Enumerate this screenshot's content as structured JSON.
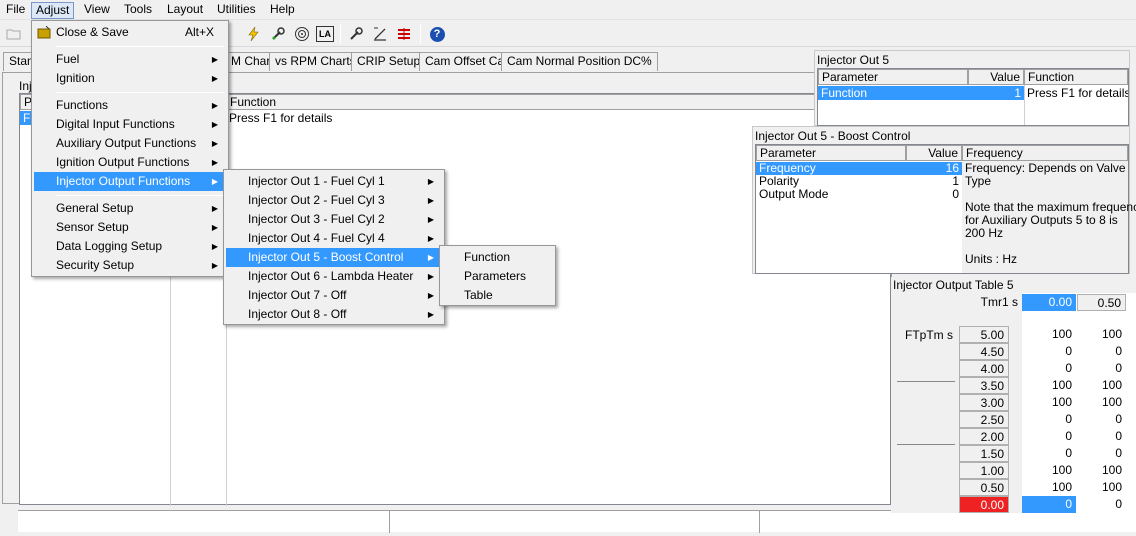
{
  "menubar": [
    "File",
    "Adjust",
    "View",
    "Tools",
    "Layout",
    "Utilities",
    "Help"
  ],
  "toolbar": {
    "icons": [
      "open-icon",
      "lightning-icon",
      "wrench-icon",
      "target-icon",
      "la-icon",
      "wrench2-icon",
      "slope-icon",
      "bars-icon",
      "help-icon"
    ],
    "la_text": "LA",
    "help_text": "?"
  },
  "tabs": [
    "Stan",
    "M Chart",
    "vs RPM Charts",
    "CRIP Setup",
    "Cam Offset Cal",
    "Cam Normal Position DC%"
  ],
  "workarea": {
    "panel_title": "Inj",
    "col_param": "P",
    "col_value": "F",
    "col_function": "Function",
    "function_text": "Press F1 for details"
  },
  "adjust_menu": {
    "items": [
      {
        "label": "Close & Save",
        "accel": "Alt+X"
      },
      {
        "label": "Fuel"
      },
      {
        "label": "Ignition"
      },
      {
        "label": "Functions"
      },
      {
        "label": "Digital Input Functions"
      },
      {
        "label": "Auxiliary Output Functions"
      },
      {
        "label": "Ignition Output Functions"
      },
      {
        "label": "Injector Output Functions"
      },
      {
        "label": "General Setup"
      },
      {
        "label": "Sensor Setup"
      },
      {
        "label": "Data Logging Setup"
      },
      {
        "label": "Security Setup"
      }
    ]
  },
  "injector_menu": {
    "items": [
      "Injector Out 1 - Fuel Cyl 1",
      "Injector Out 2 - Fuel Cyl 3",
      "Injector Out 3 - Fuel Cyl 2",
      "Injector Out 4 - Fuel Cyl 4",
      "Injector Out 5 - Boost Control",
      "Injector Out 6 - Lambda Heater",
      "Injector Out 7 - Off",
      "Injector Out 8 - Off"
    ]
  },
  "sub_menu": {
    "items": [
      "Function",
      "Parameters",
      "Table"
    ]
  },
  "panel_out5": {
    "title": "Injector Out 5",
    "col_param": "Parameter",
    "col_value": "Value",
    "col_function": "Function",
    "row_param": "Function",
    "row_value": "1",
    "row_function": "Press F1 for details"
  },
  "panel_boost": {
    "title": "Injector Out 5 - Boost Control",
    "col_param": "Parameter",
    "col_value": "Value",
    "col_freq": "Frequency",
    "rows": [
      {
        "param": "Frequency",
        "value": "16"
      },
      {
        "param": "Polarity",
        "value": "1"
      },
      {
        "param": "Output Mode",
        "value": "0"
      }
    ],
    "help_line1": "Frequency: Depends on Valve",
    "help_line2": "Type",
    "help_line3": "Note that the maximum frequency",
    "help_line4": "for Auxiliary Outputs 5 to 8 is",
    "help_line5": "200 Hz",
    "help_line6": "Units : Hz"
  },
  "table5": {
    "title": "Injector Output Table 5",
    "x_axis_label": "Tmr1 s",
    "x_values": [
      "0.00",
      "0.50"
    ],
    "y_axis_label": "FTpTm s",
    "rows": [
      {
        "y": "5.00",
        "v": [
          "100",
          "100"
        ]
      },
      {
        "y": "4.50",
        "v": [
          "0",
          "0"
        ]
      },
      {
        "y": "4.00",
        "v": [
          "0",
          "0"
        ]
      },
      {
        "y": "3.50",
        "v": [
          "100",
          "100"
        ]
      },
      {
        "y": "3.00",
        "v": [
          "100",
          "100"
        ]
      },
      {
        "y": "2.50",
        "v": [
          "0",
          "0"
        ]
      },
      {
        "y": "2.00",
        "v": [
          "0",
          "0"
        ]
      },
      {
        "y": "1.50",
        "v": [
          "0",
          "0"
        ]
      },
      {
        "y": "1.00",
        "v": [
          "100",
          "100"
        ]
      },
      {
        "y": "0.50",
        "v": [
          "100",
          "100"
        ]
      },
      {
        "y": "0.00",
        "v": [
          "0",
          "0"
        ]
      }
    ]
  },
  "colors": {
    "highlight": "#3399ff",
    "red_cell": "#ee2222",
    "blue_cell": "#3399ff"
  }
}
